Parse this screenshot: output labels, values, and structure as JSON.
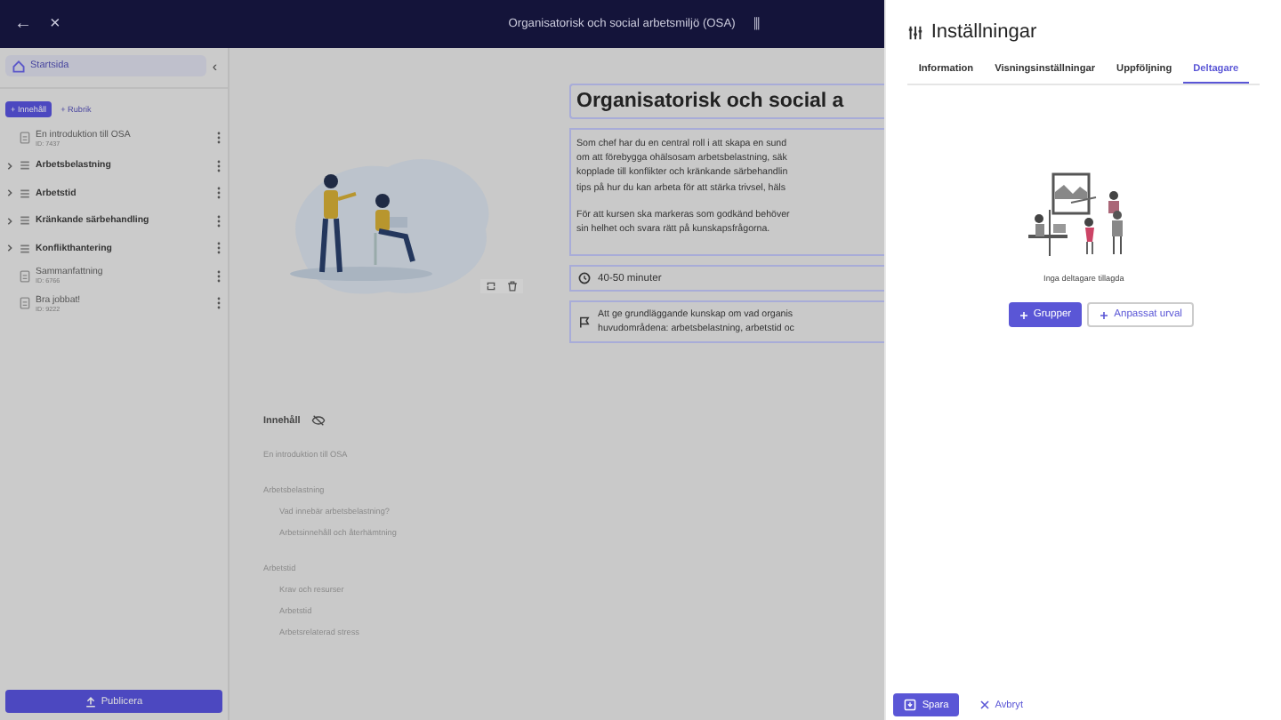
{
  "topbar": {
    "back": "←",
    "close": "×",
    "title": "Organisatorisk och social arbetsmiljö (OSA)",
    "menu": "⫼"
  },
  "sidebar": {
    "home": "Startsida",
    "collapse": "‹",
    "add_content": "+ Innehåll",
    "add_heading": "+ Rubrik",
    "items": [
      {
        "kind": "page",
        "title": "En introduktion till OSA",
        "id": "ID: 7437"
      },
      {
        "kind": "section",
        "title": "Arbetsbelastning"
      },
      {
        "kind": "section",
        "title": "Arbetstid"
      },
      {
        "kind": "section",
        "title": "Kränkande särbehandling"
      },
      {
        "kind": "section",
        "title": "Konflikthantering"
      },
      {
        "kind": "page",
        "title": "Sammanfattning",
        "id": "ID: 6766"
      },
      {
        "kind": "page",
        "title": "Bra jobbat!",
        "id": "ID: 9222"
      }
    ],
    "publish": "Publicera"
  },
  "course": {
    "title": "Organisatorisk och social a",
    "description": [
      [
        "Som chef har du en central roll i att skapa en sund",
        "om att förebygga ohälsosam arbetsbelastning, säk",
        "kopplade till konflikter och kränkande särbehandlin",
        "tips på hur du kan arbeta för att stärka trivsel, häls"
      ],
      [
        "För att kursen ska markeras som godkänd behöver",
        "sin helhet och svara rätt på kunskapsfrågorna."
      ]
    ],
    "duration": "40-50 minuter",
    "goal": [
      "Att ge grundläggande kunskap om vad organis",
      "huvudområdena: arbetsbelastning, arbetstid oc"
    ]
  },
  "contents": {
    "heading": "Innehåll",
    "items": [
      {
        "kind": "page",
        "title": "En introduktion till OSA"
      },
      {
        "kind": "section",
        "title": "Arbetsbelastning"
      },
      {
        "kind": "sub",
        "title": "Vad innebär arbetsbelastning?"
      },
      {
        "kind": "sub",
        "title": "Arbetsinnehåll och återhämtning"
      },
      {
        "kind": "section",
        "title": "Arbetstid"
      },
      {
        "kind": "sub",
        "title": "Krav och resurser"
      },
      {
        "kind": "sub",
        "title": "Arbetstid"
      },
      {
        "kind": "sub",
        "title": "Arbetsrelaterad stress"
      }
    ]
  },
  "settings": {
    "title": "Inställningar",
    "tabs": [
      {
        "label": "Information",
        "selected": false
      },
      {
        "label": "Visningsinställningar",
        "selected": false
      },
      {
        "label": "Uppföljning",
        "selected": false
      },
      {
        "label": "Deltagare",
        "selected": true
      }
    ],
    "empty_text": "Inga deltagare tillagda",
    "groups": "Grupper",
    "custom": "Anpassat urval",
    "save": "Spara",
    "cancel": "Avbryt"
  }
}
